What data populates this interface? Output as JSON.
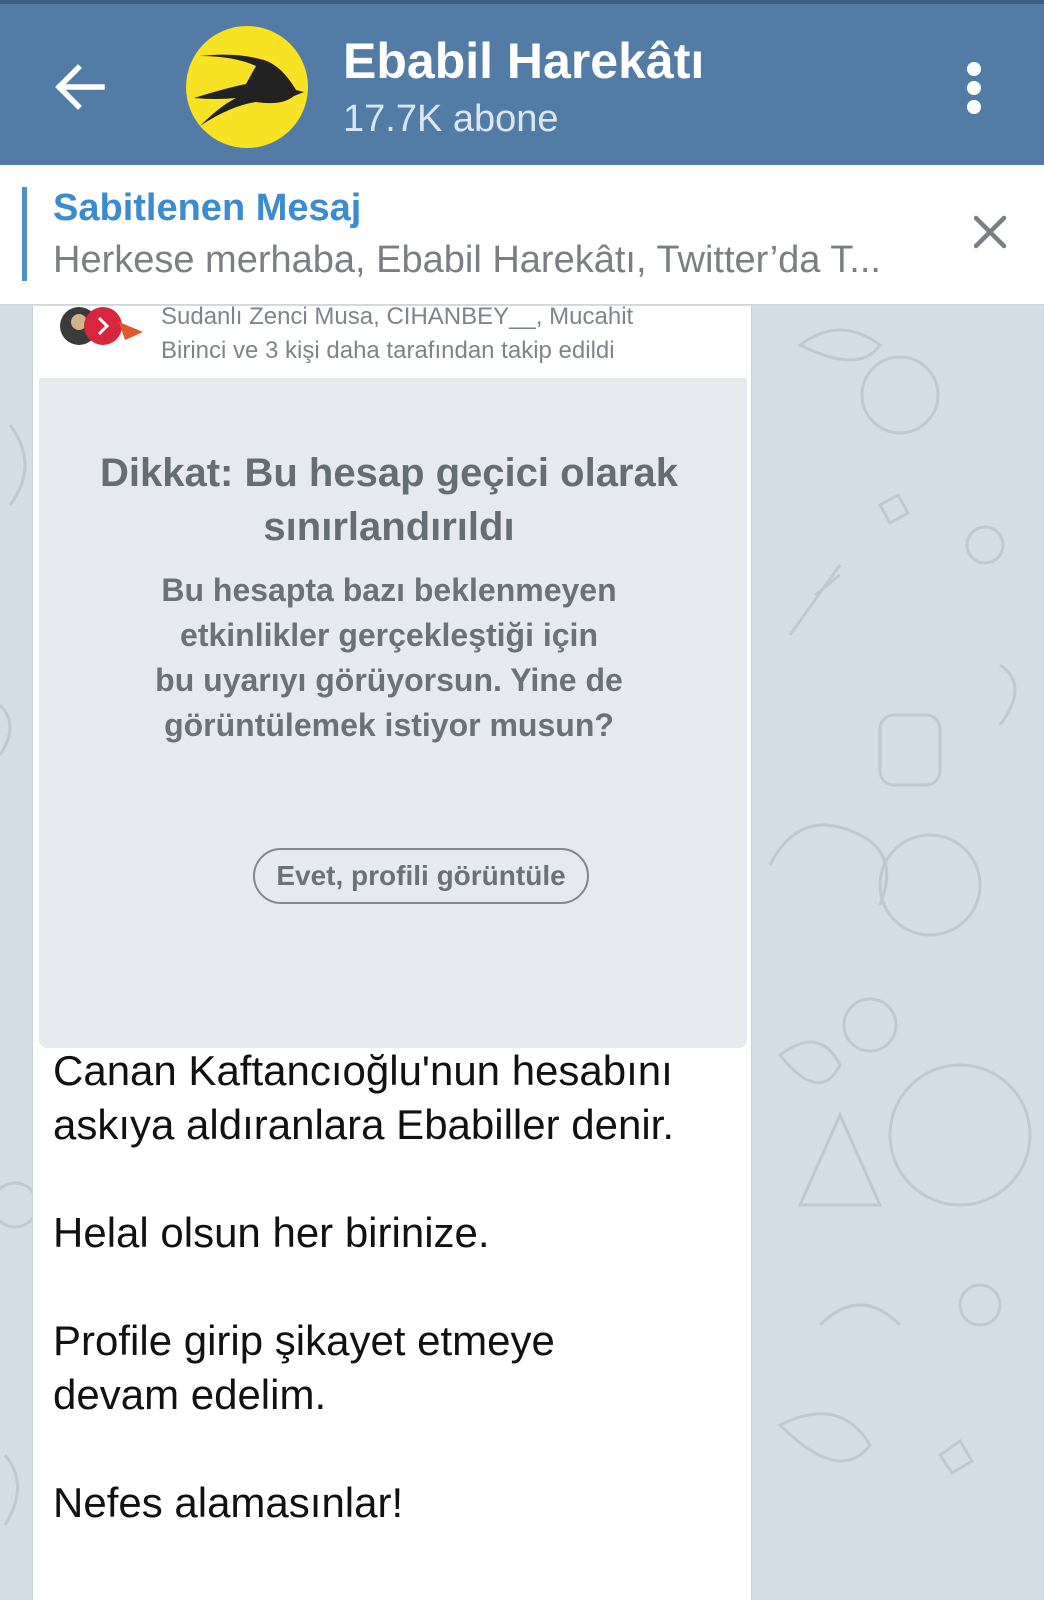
{
  "header": {
    "channel_name": "Ebabil Harekâtı",
    "subscribers": "17.7K abone",
    "back_icon": "arrow-left-icon",
    "menu_icon": "more-vertical-icon",
    "avatar_color": "#f7e223",
    "bar_color": "#527ca5"
  },
  "pinned": {
    "title": "Sabitlenen Mesaj",
    "text": "Herkese merhaba, Ebabil Harekâtı, Twitter’da T...",
    "close_icon": "close-icon",
    "accent": "#3a8bd0"
  },
  "message": {
    "screenshot": {
      "followers_line1": "Sudanlı Zenci Musa, CIHANBEY__, Mucahit",
      "followers_line2": "Birinci ve 3 kişi daha tarafından takip edildi",
      "warning_title": "Dikkat: Bu hesap geçici olarak sınırlandırıldı",
      "warning_line1": "Bu hesapta bazı beklenmeyen",
      "warning_line2": "etkinlikler gerçekleştiği için",
      "warning_line3": "bu uyarıyı görüyorsun. Yine de",
      "warning_line4": "görüntülemek istiyor musun?",
      "warning_button": "Evet, profili görüntüle"
    },
    "line1": "Canan Kaftancıoğlu'nun hesabını",
    "line2": "askıya aldıranlara Ebabiller denir.",
    "line3": "Helal olsun her birinize.",
    "line4": "Profile girip şikayet etmeye",
    "line5": "devam edelim.",
    "line6": "Nefes alamasınlar!"
  }
}
